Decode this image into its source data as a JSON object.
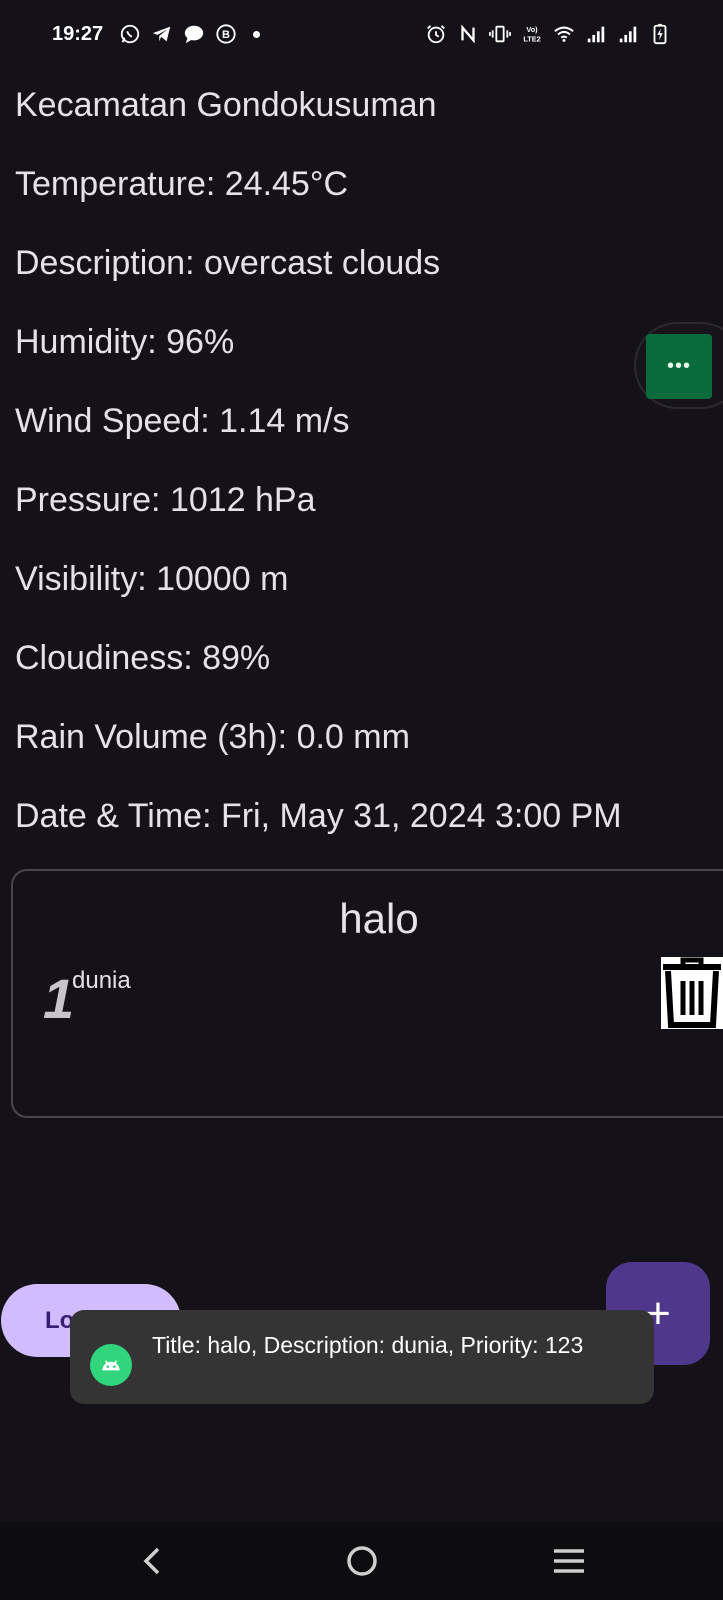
{
  "status_bar": {
    "time": "19:27",
    "left_icons": [
      "whatsapp-icon",
      "telegram-icon",
      "chat-bubble-icon",
      "b-circle-icon"
    ],
    "right_icons": [
      "alarm-icon",
      "nfc-icon",
      "vibrate-icon",
      "volte-icon",
      "wifi-icon",
      "signal-icon",
      "signal-icon",
      "battery-charging-icon"
    ],
    "volte_label": "Vo) LTE2"
  },
  "weather": {
    "location": "Kecamatan Gondokusuman",
    "temperature": "Temperature: 24.45°C",
    "description": "Description: overcast clouds",
    "humidity": "Humidity: 96%",
    "wind_speed": "Wind Speed: 1.14 m/s",
    "pressure": "Pressure: 1012 hPa",
    "visibility": "Visibility: 10000 m",
    "cloudiness": "Cloudiness: 89%",
    "rain_volume": "Rain Volume (3h): 0.0 mm",
    "date_time": "Date & Time: Fri, May 31, 2024 3:00 PM"
  },
  "bubble": {
    "label": "•••"
  },
  "note": {
    "title": "halo",
    "priority": "1",
    "description": "dunia",
    "delete_icon": "trash-icon"
  },
  "buttons": {
    "logout_label": "Lo",
    "fab_label": "+"
  },
  "toast": {
    "text": "Title: halo, Description: dunia, Priority: 123",
    "icon": "android-icon"
  },
  "nav": {
    "back_icon": "back-chevron-icon",
    "home_icon": "home-circle-icon",
    "recents_icon": "menu-lines-icon"
  },
  "colors": {
    "background": "#141218",
    "text": "#e6e0e9",
    "logout_bg": "#d0bcff",
    "fab_bg": "#4f378b",
    "toast_bg": "#343434",
    "bubble_green": "#0a6b3a",
    "android_green": "#30d57c"
  }
}
